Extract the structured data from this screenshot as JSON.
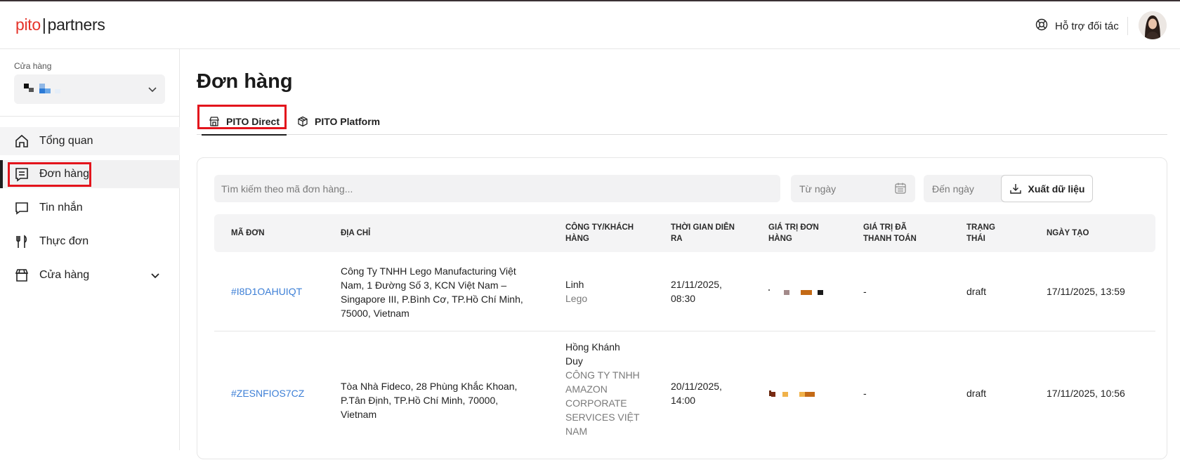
{
  "app": {
    "logo": {
      "pito": "pito",
      "sep": "|",
      "partners": "partners"
    },
    "support_label": "Hỗ trợ đối tác"
  },
  "sidebar": {
    "store_label": "Cửa hàng",
    "nav": [
      {
        "label": "Tổng quan",
        "icon": "home-icon"
      },
      {
        "label": "Đơn hàng",
        "icon": "receipt-icon"
      },
      {
        "label": "Tin nhắn",
        "icon": "message-icon"
      },
      {
        "label": "Thực đơn",
        "icon": "fork-knife-icon"
      },
      {
        "label": "Cửa hàng",
        "icon": "store-icon"
      }
    ]
  },
  "main": {
    "title": "Đơn hàng",
    "tabs": [
      {
        "label": "PITO Direct",
        "icon": "store-icon",
        "active": true
      },
      {
        "label": "PITO Platform",
        "icon": "box-icon",
        "active": false
      }
    ],
    "toolbar": {
      "search_placeholder": "Tìm kiếm theo mã đơn hàng...",
      "from_date": "Từ ngày",
      "to_date": "Đến ngày",
      "export_label": "Xuất dữ liệu"
    },
    "table": {
      "headers": {
        "code": "MÃ ĐƠN",
        "address": "ĐỊA CHỈ",
        "company": "CÔNG TY/KHÁCH HÀNG",
        "time": "THỜI GIAN DIỄN RA",
        "order_value": "GIÁ TRỊ ĐƠN HÀNG",
        "paid_value": "GIÁ TRỊ ĐÃ THANH TOÁN",
        "status": "TRẠNG THÁI",
        "created": "NGÀY TẠO"
      },
      "rows": [
        {
          "code": "#I8D1OAHUIQT",
          "address": "Công Ty TNHH Lego Manufacturing Việt Nam, 1 Đường Số 3, KCN Việt Nam – Singapore III, P.Bình Cơ, TP.Hồ Chí Minh, 75000, Vietnam",
          "customer": "Linh",
          "company": "Lego",
          "time": "21/11/2025, 08:30",
          "paid": "-",
          "status": "draft",
          "created": "17/11/2025, 13:59"
        },
        {
          "code": "#ZESNFIOS7CZ",
          "address": "Tòa Nhà Fideco, 28 Phùng Khắc Khoan, P.Tân Định, TP.Hồ Chí Minh, 70000, Vietnam",
          "customer": "Hồng Khánh Duy",
          "company": "CÔNG TY TNHH AMAZON CORPORATE SERVICES VIỆT NAM",
          "time": "20/11/2025, 14:00",
          "paid": "-",
          "status": "draft",
          "created": "17/11/2025, 10:56"
        }
      ]
    }
  },
  "colors": {
    "brand": "#e5352b",
    "link": "#3d7fd6",
    "highlight": "#e3141c"
  }
}
